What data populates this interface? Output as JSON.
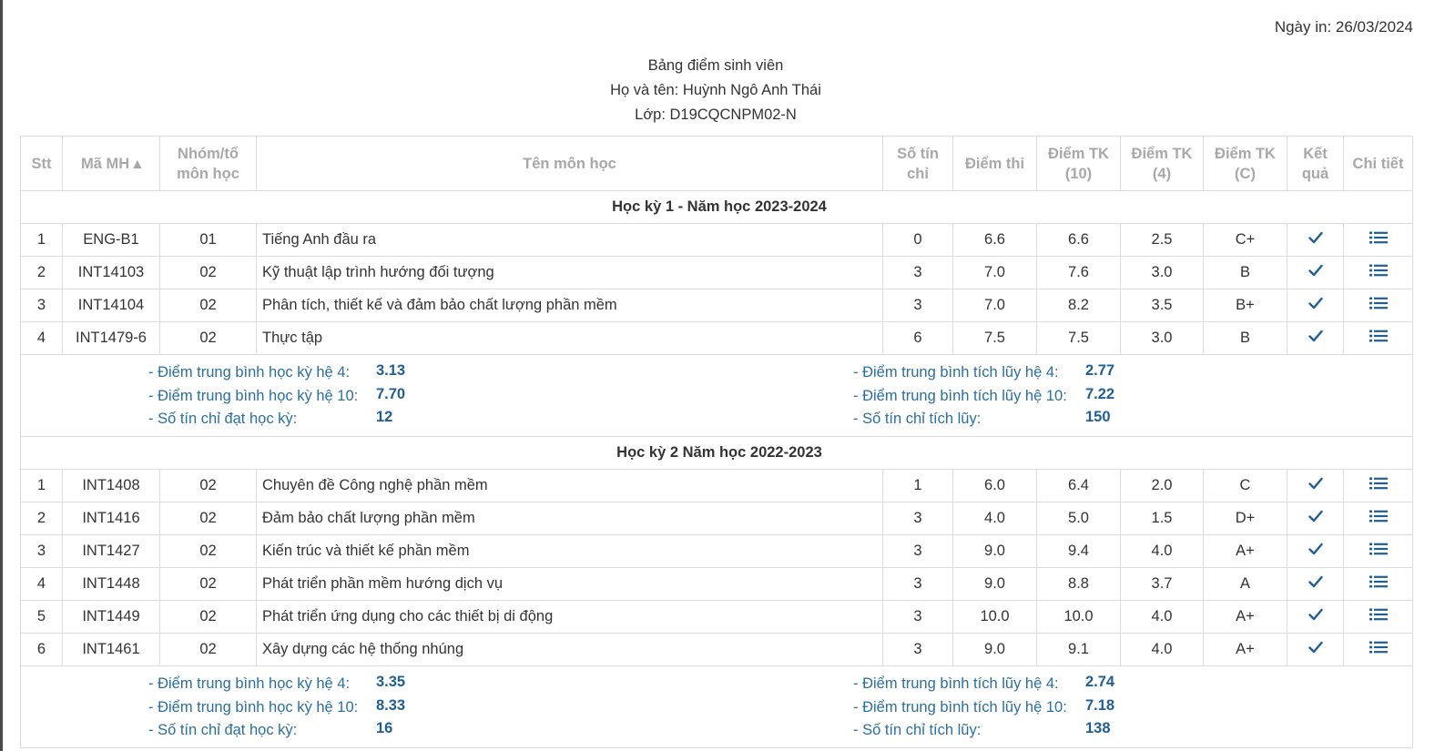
{
  "print_date": "Ngày in: 26/03/2024",
  "header": {
    "title": "Bảng điểm sinh viên",
    "student_name": "Họ và tên: Huỳnh Ngô Anh Thái",
    "class_name": "Lớp: D19CQCNPM02-N"
  },
  "columns": {
    "stt": "Stt",
    "code": "Mã MH ▴",
    "group_l1": "Nhóm/tổ",
    "group_l2": "môn học",
    "name": "Tên môn học",
    "credits_l1": "Số tín",
    "credits_l2": "chỉ",
    "exam": "Điểm thi",
    "tk10_l1": "Điểm TK",
    "tk10_l2": "(10)",
    "tk4_l1": "Điểm TK",
    "tk4_l2": "(4)",
    "tkc_l1": "Điểm TK",
    "tkc_l2": "(C)",
    "result_l1": "Kết",
    "result_l2": "quả",
    "detail": "Chi tiết"
  },
  "summary_labels": {
    "sem_gpa4": "- Điểm trung bình học kỳ hệ 4:",
    "sem_gpa10": "- Điểm trung bình học kỳ hệ 10:",
    "sem_credits": "- Số tín chỉ đạt học kỳ:",
    "cum_gpa4": "- Điểm trung bình tích lũy hệ 4:",
    "cum_gpa10": "- Điểm trung bình tích lũy hệ 10:",
    "cum_credits": "- Số tín chỉ tích lũy:"
  },
  "icons": {
    "result": "check-icon",
    "detail": "list-icon",
    "accent": "#1f5f95"
  },
  "semesters": [
    {
      "title": "Học kỳ 1 - Năm học 2023-2024",
      "courses": [
        {
          "stt": "1",
          "code": "ENG-B1",
          "group": "01",
          "name": "Tiếng Anh đầu ra",
          "credits": "0",
          "exam": "6.6",
          "tk10": "6.6",
          "tk4": "2.5",
          "tkc": "C+"
        },
        {
          "stt": "2",
          "code": "INT14103",
          "group": "02",
          "name": "Kỹ thuật lập trình hướng đối tượng",
          "credits": "3",
          "exam": "7.0",
          "tk10": "7.6",
          "tk4": "3.0",
          "tkc": "B"
        },
        {
          "stt": "3",
          "code": "INT14104",
          "group": "02",
          "name": "Phân tích, thiết kế và đảm bảo chất lượng phần mềm",
          "credits": "3",
          "exam": "7.0",
          "tk10": "8.2",
          "tk4": "3.5",
          "tkc": "B+"
        },
        {
          "stt": "4",
          "code": "INT1479-6",
          "group": "02",
          "name": "Thực tập",
          "credits": "6",
          "exam": "7.5",
          "tk10": "7.5",
          "tk4": "3.0",
          "tkc": "B"
        }
      ],
      "summary": {
        "sem_gpa4": "3.13",
        "sem_gpa10": "7.70",
        "sem_credits": "12",
        "cum_gpa4": "2.77",
        "cum_gpa10": "7.22",
        "cum_credits": "150"
      }
    },
    {
      "title": "Học kỳ 2 Năm học 2022-2023",
      "courses": [
        {
          "stt": "1",
          "code": "INT1408",
          "group": "02",
          "name": "Chuyên đề Công nghệ phần mềm",
          "credits": "1",
          "exam": "6.0",
          "tk10": "6.4",
          "tk4": "2.0",
          "tkc": "C"
        },
        {
          "stt": "2",
          "code": "INT1416",
          "group": "02",
          "name": "Đảm bảo chất lượng phần mềm",
          "credits": "3",
          "exam": "4.0",
          "tk10": "5.0",
          "tk4": "1.5",
          "tkc": "D+"
        },
        {
          "stt": "3",
          "code": "INT1427",
          "group": "02",
          "name": "Kiến trúc và thiết kế phần mềm",
          "credits": "3",
          "exam": "9.0",
          "tk10": "9.4",
          "tk4": "4.0",
          "tkc": "A+"
        },
        {
          "stt": "4",
          "code": "INT1448",
          "group": "02",
          "name": "Phát triển phần mềm hướng dịch vụ",
          "credits": "3",
          "exam": "9.0",
          "tk10": "8.8",
          "tk4": "3.7",
          "tkc": "A"
        },
        {
          "stt": "5",
          "code": "INT1449",
          "group": "02",
          "name": "Phát triển ứng dụng cho các thiết bị di động",
          "credits": "3",
          "exam": "10.0",
          "tk10": "10.0",
          "tk4": "4.0",
          "tkc": "A+"
        },
        {
          "stt": "6",
          "code": "INT1461",
          "group": "02",
          "name": "Xây dựng các hệ thống nhúng",
          "credits": "3",
          "exam": "9.0",
          "tk10": "9.1",
          "tk4": "4.0",
          "tkc": "A+"
        }
      ],
      "summary": {
        "sem_gpa4": "3.35",
        "sem_gpa10": "8.33",
        "sem_credits": "16",
        "cum_gpa4": "2.74",
        "cum_gpa10": "7.18",
        "cum_credits": "138"
      }
    }
  ]
}
